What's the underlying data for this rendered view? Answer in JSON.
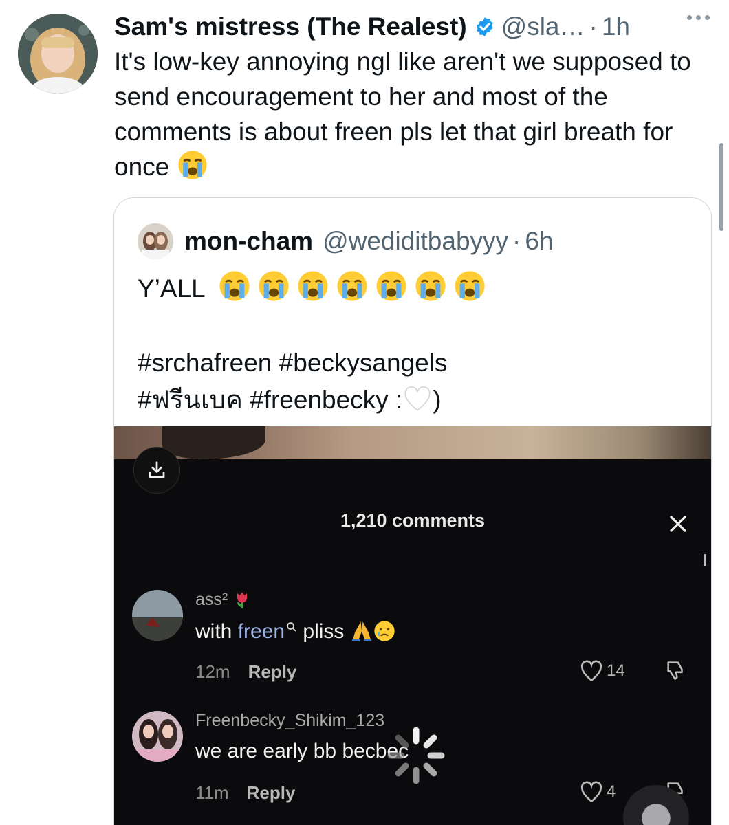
{
  "tweet": {
    "display_name": "Sam's mistress (The Realest)",
    "handle": "@sla…",
    "separator": "·",
    "time": "1h",
    "text": "It's low-key annoying ngl like aren't we supposed to send encouragement to her and most of the comments is about freen pls let that girl breath for once",
    "text_emoji": "loudly-crying-face"
  },
  "quoted": {
    "display_name": "mon-cham",
    "handle": "@wediditbabyyy",
    "separator": "·",
    "time": "6h",
    "line1": "Y’ALL",
    "line1_emoji_count": 7,
    "line1_emoji": "loudly-crying-face",
    "hashtags_line1": "#srchafreen #beckysangels",
    "hashtags_line2_a": "#ฟรีนเบค #freenbecky :",
    "hashtags_line2_emoji": "white-heart",
    "hashtags_line2_b": ")"
  },
  "video": {
    "comments_count": "1,210 comments",
    "comments": [
      {
        "user": "ass²",
        "user_emoji": "tulip",
        "text_a": "with ",
        "mention": "freen",
        "text_b": " pliss",
        "text_emojis": [
          "folded-hands",
          "crying-face"
        ],
        "time": "12m",
        "reply": "Reply",
        "likes": "14"
      },
      {
        "user": "Freenbecky_Shikim_123",
        "text": "we are early bb becbec",
        "time": "11m",
        "reply": "Reply",
        "likes": "4"
      }
    ]
  },
  "colors": {
    "text": "#0f1419",
    "secondary": "#536471",
    "verified": "#1d9bf0",
    "sheet": "#0b0b0d"
  }
}
